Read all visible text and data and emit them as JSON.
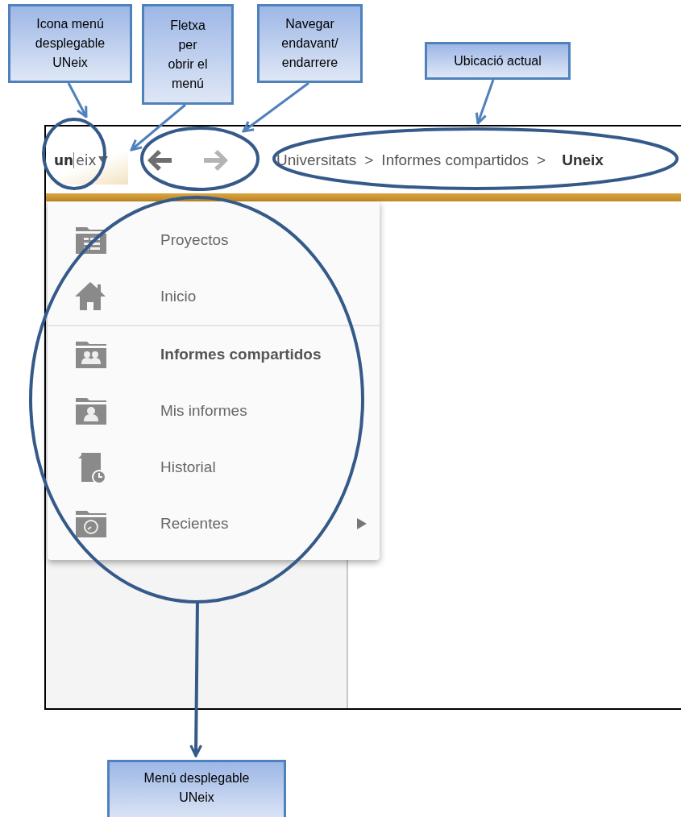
{
  "callouts": [
    {
      "lines": [
        "Icona menú",
        "desplegable",
        "UNeix"
      ]
    },
    {
      "lines": [
        "Fletxa",
        "per",
        "obrir el",
        "menú"
      ]
    },
    {
      "lines": [
        "Navegar",
        "endavant/",
        "endarrere"
      ]
    },
    {
      "lines": [
        "Ubicació actual"
      ]
    },
    {
      "lines": [
        "Menú desplegable",
        "UNeix"
      ]
    }
  ],
  "app": {
    "logo": {
      "left": "un",
      "right": "eix"
    },
    "nav": {
      "back_enabled": true,
      "forward_enabled": false
    },
    "breadcrumb": [
      {
        "kind": "crumb",
        "label": "Universitats",
        "current": false
      },
      {
        "kind": "separator",
        "label": ">"
      },
      {
        "kind": "crumb",
        "label": "Informes compartidos",
        "current": false
      },
      {
        "kind": "separator",
        "label": ">"
      },
      {
        "kind": "crumb",
        "label": "Uneix",
        "current": true
      }
    ],
    "menu": [
      {
        "label": "Proyectos",
        "kind": "folder-list",
        "selected": false,
        "submenu": false,
        "divider_after": false
      },
      {
        "label": "Inicio",
        "kind": "home",
        "selected": false,
        "submenu": false,
        "divider_after": true
      },
      {
        "label": "Informes compartidos",
        "kind": "folder-group",
        "selected": true,
        "submenu": false,
        "divider_after": false
      },
      {
        "label": "Mis informes",
        "kind": "folder-person",
        "selected": false,
        "submenu": false,
        "divider_after": false
      },
      {
        "label": "Historial",
        "kind": "document-clock",
        "selected": false,
        "submenu": false,
        "divider_after": false
      },
      {
        "label": "Recientes",
        "kind": "folder-clock",
        "selected": false,
        "submenu": true,
        "divider_after": false
      }
    ]
  }
}
